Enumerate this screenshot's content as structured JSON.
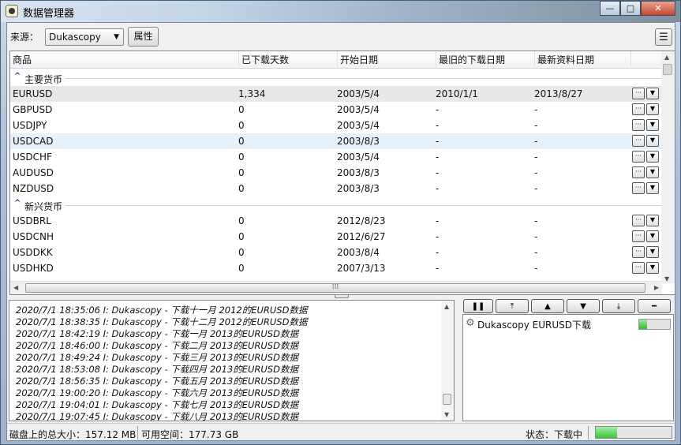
{
  "window": {
    "title": "数据管理器",
    "minimize_label": "—",
    "maximize_label": "□",
    "close_label": "✕"
  },
  "toolbar": {
    "source_label": "来源：",
    "source_value": "Dukascopy",
    "properties_label": "属性",
    "menu_icon": "☰"
  },
  "grid": {
    "columns": [
      "商品",
      "已下载天数",
      "开始日期",
      "最旧的下载日期",
      "最新资料日期"
    ],
    "groups": [
      {
        "name": "主要货币",
        "rows": [
          {
            "symbol": "EURUSD",
            "days": "1,334",
            "start": "2003/5/4",
            "oldest": "2010/1/1",
            "latest": "2013/8/27"
          },
          {
            "symbol": "GBPUSD",
            "days": "0",
            "start": "2003/5/4",
            "oldest": "-",
            "latest": "-"
          },
          {
            "symbol": "USDJPY",
            "days": "0",
            "start": "2003/5/4",
            "oldest": "-",
            "latest": "-"
          },
          {
            "symbol": "USDCAD",
            "days": "0",
            "start": "2003/8/3",
            "oldest": "-",
            "latest": "-"
          },
          {
            "symbol": "USDCHF",
            "days": "0",
            "start": "2003/5/4",
            "oldest": "-",
            "latest": "-"
          },
          {
            "symbol": "AUDUSD",
            "days": "0",
            "start": "2003/8/3",
            "oldest": "-",
            "latest": "-"
          },
          {
            "symbol": "NZDUSD",
            "days": "0",
            "start": "2003/8/3",
            "oldest": "-",
            "latest": "-"
          }
        ]
      },
      {
        "name": "新兴货币",
        "rows": [
          {
            "symbol": "USDBRL",
            "days": "0",
            "start": "2012/8/23",
            "oldest": "-",
            "latest": "-"
          },
          {
            "symbol": "USDCNH",
            "days": "0",
            "start": "2012/6/27",
            "oldest": "-",
            "latest": "-"
          },
          {
            "symbol": "USDDKK",
            "days": "0",
            "start": "2003/8/4",
            "oldest": "-",
            "latest": "-"
          },
          {
            "symbol": "USDHKD",
            "days": "0",
            "start": "2007/3/13",
            "oldest": "-",
            "latest": "-"
          }
        ]
      }
    ],
    "row_buttons": {
      "more": "···",
      "dropdown": "▼"
    }
  },
  "log": [
    "2020/7/1 18:35:06  I: Dukascopy - 下载十一月 2012的EURUSD数据",
    "2020/7/1 18:38:35  I: Dukascopy - 下载十二月 2012的EURUSD数据",
    "2020/7/1 18:42:19  I: Dukascopy - 下载一月 2013的EURUSD数据",
    "2020/7/1 18:46:00  I: Dukascopy - 下载二月 2013的EURUSD数据",
    "2020/7/1 18:49:24  I: Dukascopy - 下载三月 2013的EURUSD数据",
    "2020/7/1 18:53:08  I: Dukascopy - 下载四月 2013的EURUSD数据",
    "2020/7/1 18:56:35  I: Dukascopy - 下载五月 2013的EURUSD数据",
    "2020/7/1 19:00:20  I: Dukascopy - 下载六月 2013的EURUSD数据",
    "2020/7/1 19:04:01  I: Dukascopy - 下载七月 2013的EURUSD数据",
    "2020/7/1 19:07:45  I: Dukascopy - 下载八月 2013的EURUSD数据"
  ],
  "queue": {
    "buttons": [
      "❚❚",
      "⤒",
      "▲",
      "▼",
      "⤓",
      "━"
    ],
    "items": [
      {
        "label": "Dukascopy EURUSD下载",
        "progress": 0.25
      }
    ]
  },
  "status": {
    "disk_total": "磁盘上的总大小：157.12 MB",
    "free_space": "可用空间：177.73 GB",
    "state": "状态：下载中",
    "progress": 0.28
  },
  "colors": {
    "accent": "#1a3c7a",
    "progress_green": "#37c437",
    "selection": "#e5f1fb"
  }
}
